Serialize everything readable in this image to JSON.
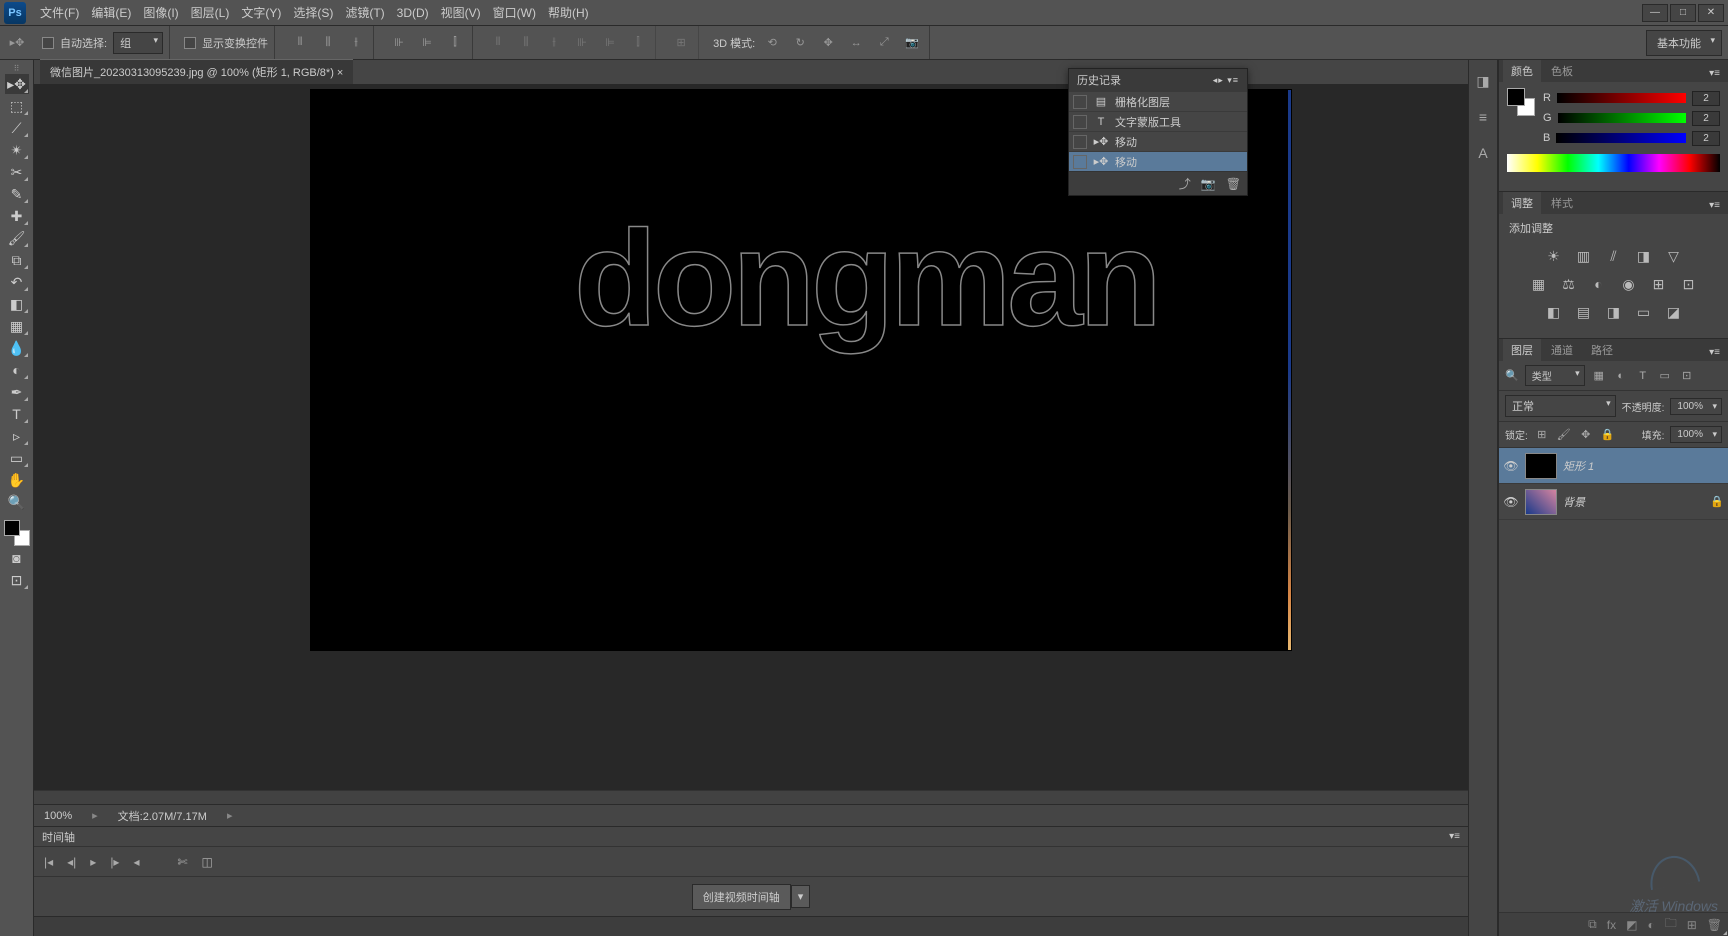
{
  "app": {
    "logo": "Ps"
  },
  "menu": {
    "file": "文件(F)",
    "edit": "编辑(E)",
    "image": "图像(I)",
    "layer": "图层(L)",
    "type": "文字(Y)",
    "select": "选择(S)",
    "filter": "滤镜(T)",
    "threeD": "3D(D)",
    "view": "视图(V)",
    "window": "窗口(W)",
    "help": "帮助(H)"
  },
  "options": {
    "autoSelect": "自动选择:",
    "group": "组",
    "showTransform": "显示变换控件",
    "threeDMode": "3D 模式:",
    "basicWorkspace": "基本功能"
  },
  "document": {
    "tabTitle": "微信图片_20230313095239.jpg @ 100% (矩形 1, RGB/8*) ×",
    "selectionText": "dongman"
  },
  "status": {
    "zoom": "100%",
    "docSize": "文档:2.07M/7.17M"
  },
  "timeline": {
    "title": "时间轴",
    "createBtn": "创建视频时间轴"
  },
  "history": {
    "title": "历史记录",
    "items": [
      "栅格化图层",
      "文字蒙版工具",
      "移动",
      "移动"
    ]
  },
  "colorPanel": {
    "tab1": "颜色",
    "tab2": "色板",
    "r": "R",
    "g": "G",
    "b": "B",
    "val": "2"
  },
  "adjustPanel": {
    "tab1": "调整",
    "tab2": "样式",
    "label": "添加调整"
  },
  "layersPanel": {
    "tab1": "图层",
    "tab2": "通道",
    "tab3": "路径",
    "filterKind": "类型",
    "blendMode": "正常",
    "opacityLabel": "不透明度:",
    "opacityVal": "100%",
    "lockLabel": "锁定:",
    "fillLabel": "填充:",
    "fillVal": "100%",
    "layer1": "矩形 1",
    "layer2": "背景"
  },
  "watermark": "激活 Windows"
}
